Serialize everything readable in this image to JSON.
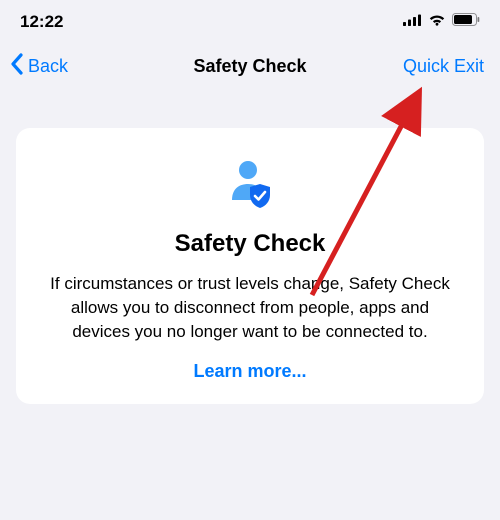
{
  "status": {
    "time": "12:22"
  },
  "nav": {
    "back_label": "Back",
    "title": "Safety Check",
    "quick_exit_label": "Quick Exit"
  },
  "card": {
    "title": "Safety Check",
    "description": "If circumstances or trust levels change, Safety Check allows you to disconnect from people, apps and devices you no longer want to be connected to.",
    "learn_more_label": "Learn more..."
  },
  "colors": {
    "accent": "#007aff",
    "icon_person": "#4fa8f7",
    "icon_shield": "#1169f0",
    "annotation_arrow": "#d62020"
  }
}
